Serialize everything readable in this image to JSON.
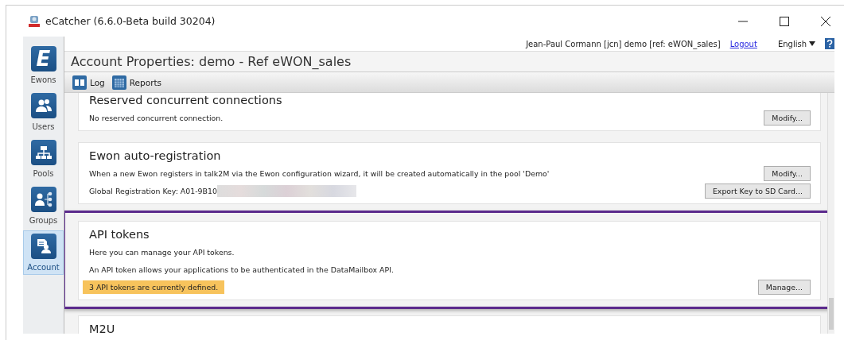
{
  "window": {
    "title": "eCatcher (6.6.0-Beta build 30204)"
  },
  "sidebar": {
    "items": [
      {
        "label": "Ewons",
        "kind": "letter",
        "glyph": "E",
        "selected": false
      },
      {
        "label": "Users",
        "kind": "users",
        "selected": false
      },
      {
        "label": "Pools",
        "kind": "pools",
        "selected": false
      },
      {
        "label": "Groups",
        "kind": "groups",
        "selected": false
      },
      {
        "label": "Account",
        "kind": "account",
        "selected": true
      }
    ]
  },
  "user_bar": {
    "user": "Jean-Paul Cormann [jcn] demo [ref: eWON_sales]",
    "logout": "Logout",
    "language": "English"
  },
  "header": {
    "title": "Account Properties: demo - Ref eWON_sales"
  },
  "toolbar": [
    {
      "label": "Log",
      "kind": "book"
    },
    {
      "label": "Reports",
      "kind": "calendar"
    }
  ],
  "sections": [
    {
      "title": "Reserved concurrent connections",
      "highlighted": false,
      "lines": [
        {
          "text": "No reserved concurrent connection.",
          "kind": "plain"
        }
      ],
      "buttons": [
        "Modify..."
      ]
    },
    {
      "title": "Ewon auto-registration",
      "highlighted": false,
      "lines": [
        {
          "text": "When a new Ewon registers in talk2M via the Ewon configuration wizard, it will be created automatically in the pool 'Demo'",
          "kind": "plain"
        },
        {
          "text": "Global Registration Key: A01-9B10",
          "kind": "key"
        }
      ],
      "buttons": [
        "Modify...",
        "Export Key to SD Card..."
      ]
    },
    {
      "title": "API tokens",
      "highlighted": true,
      "lines": [
        {
          "text": "Here you can manage your API tokens.",
          "kind": "plain"
        },
        {
          "text": "An API token allows your applications to be authenticated in the DataMailbox API.",
          "kind": "plain"
        },
        {
          "text": "3 API tokens are currently defined.",
          "kind": "notice"
        }
      ],
      "buttons": [
        "Manage..."
      ]
    },
    {
      "title": "M2U",
      "highlighted": false
    }
  ]
}
